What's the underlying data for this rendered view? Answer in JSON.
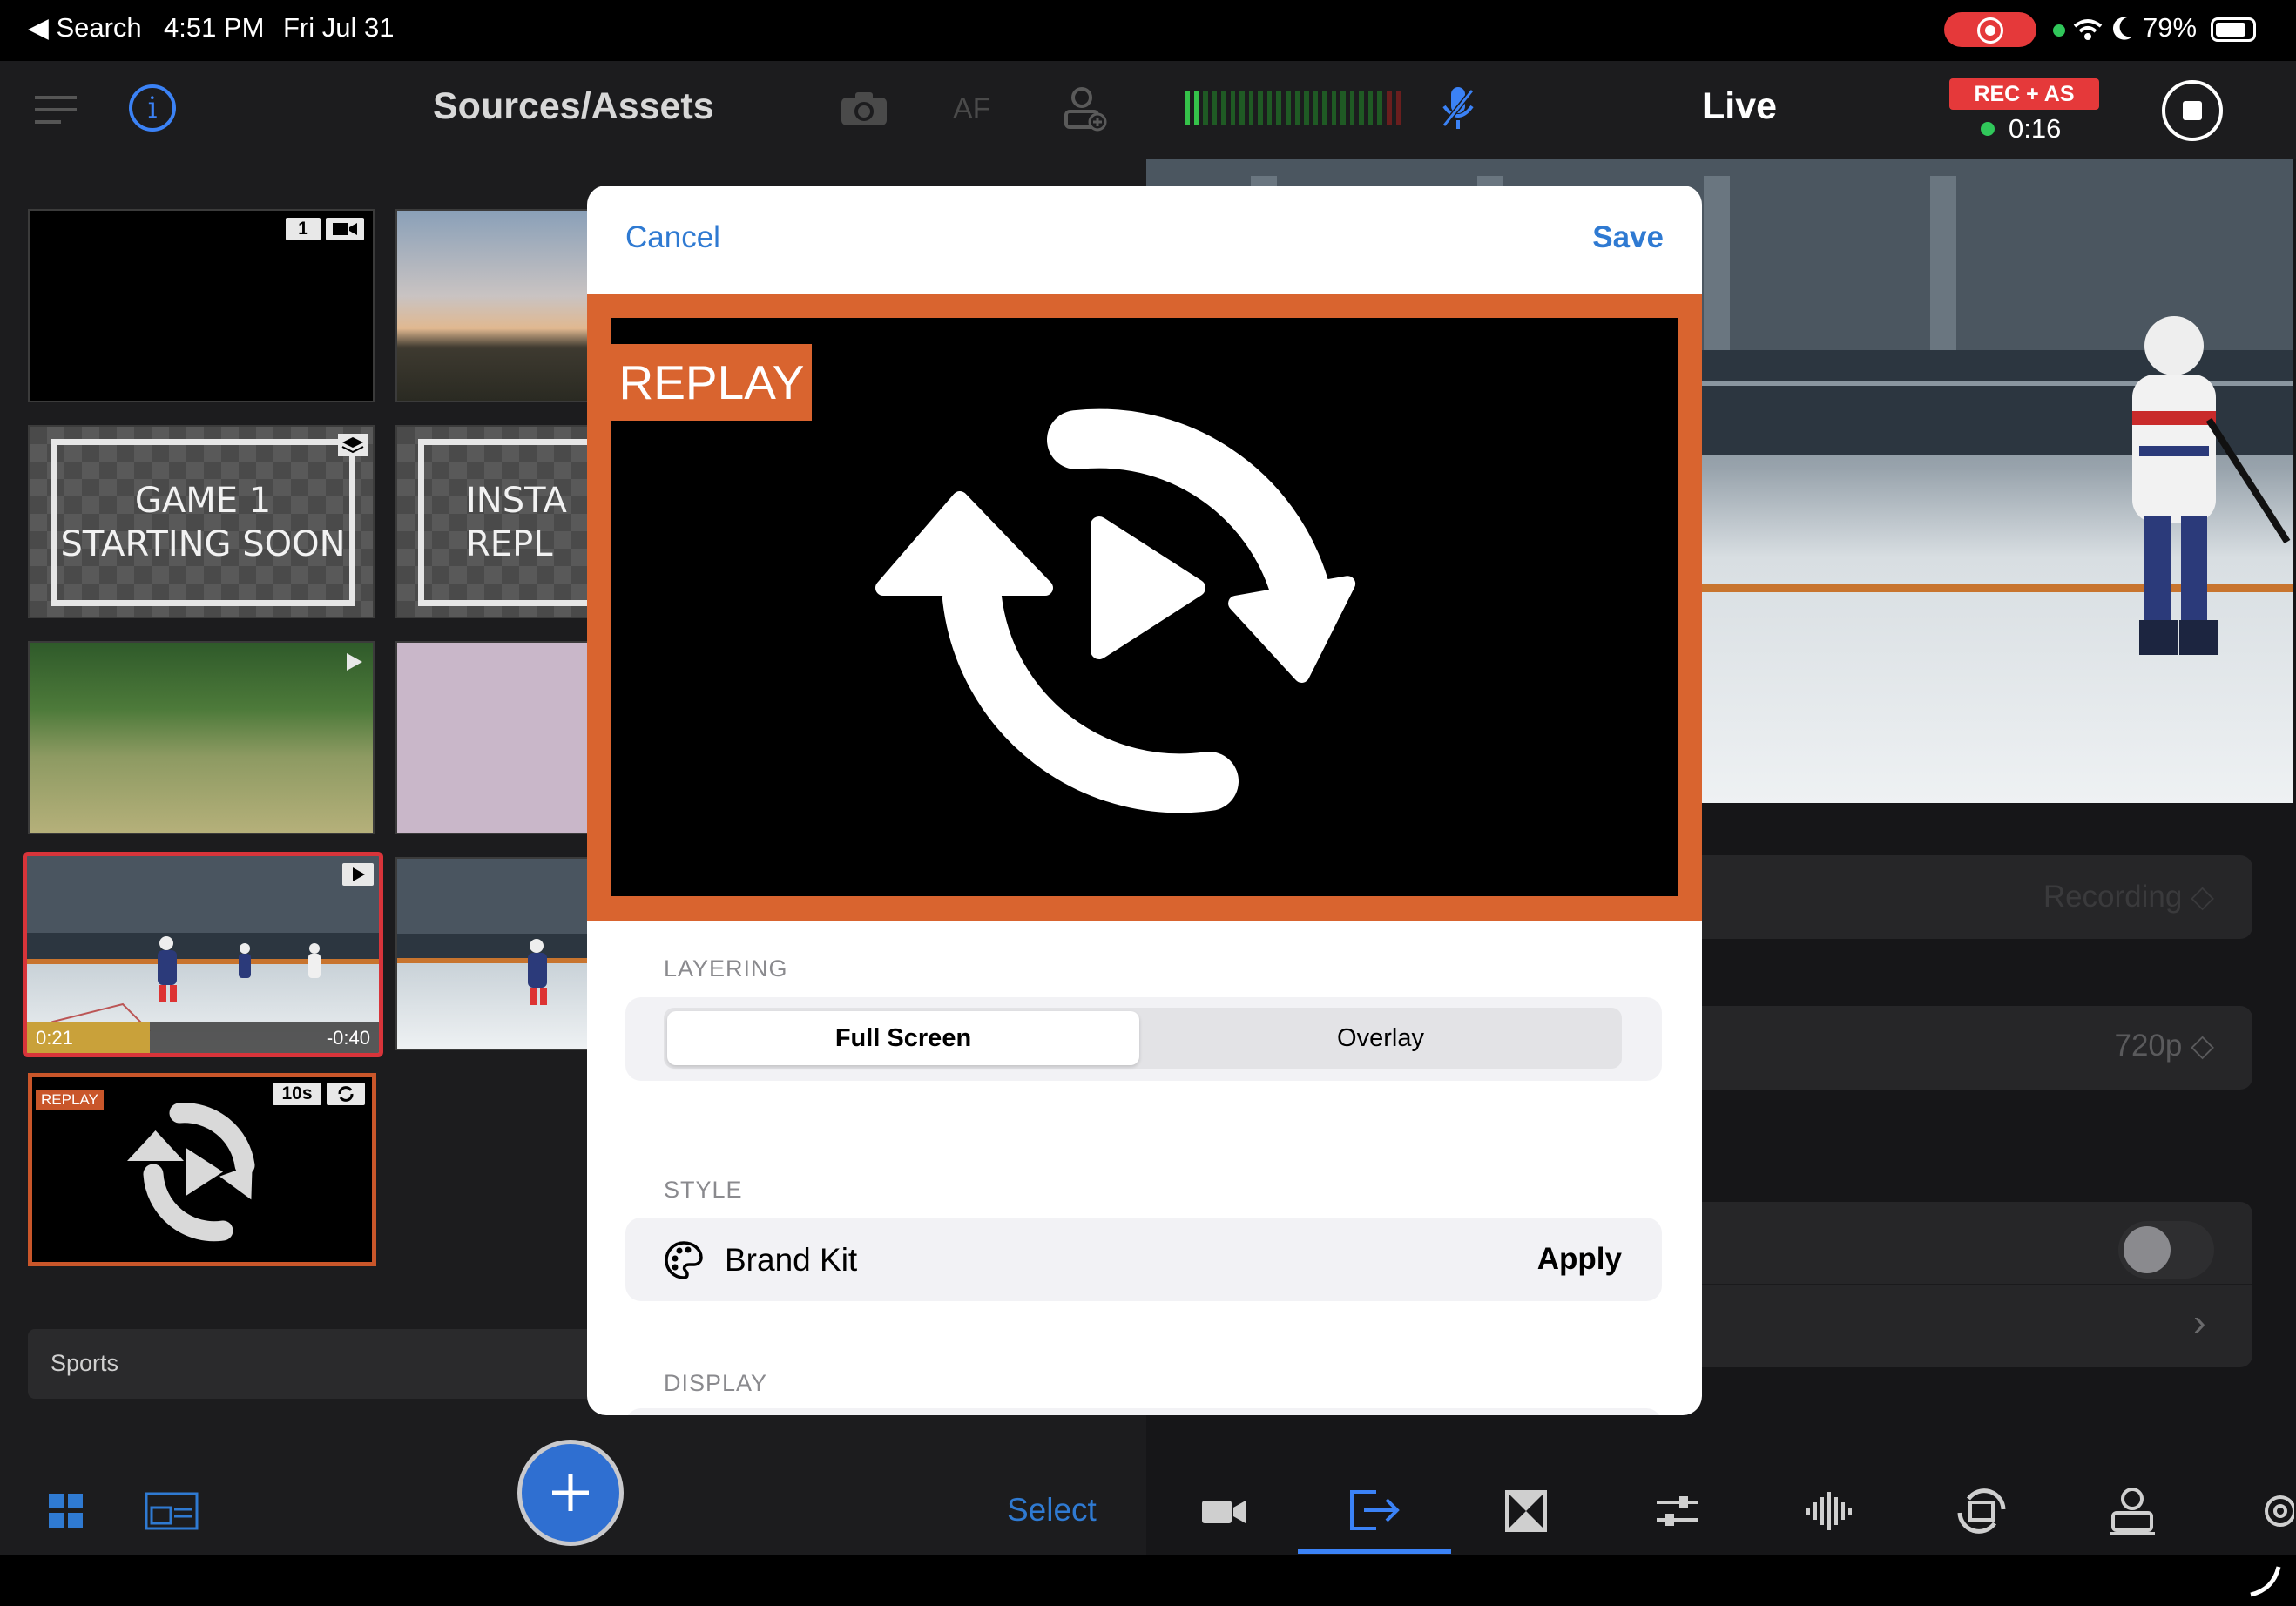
{
  "status_bar": {
    "back_label": "◀ Search",
    "time": "4:51 PM",
    "date": "Fri Jul 31",
    "battery": "79%"
  },
  "sources": {
    "title": "Sources/Assets",
    "af_label": "AF",
    "thumbs": {
      "camera_badge_num": "1",
      "title_card_text": "GAME 1\nSTARTING SOON",
      "instant_replay_text": "INSTA\nREPL",
      "clip_elapsed": "0:21",
      "clip_remaining": "-0:40",
      "clip_progress": 0.35,
      "replay_badge": "REPLAY",
      "replay_duration": "10s"
    },
    "scene_name": "Sports",
    "select_label": "Select"
  },
  "live": {
    "title": "Live",
    "rec_badge": "REC + AS",
    "rec_time": "0:16",
    "recording_option": "Recording ◇",
    "resolution_option": "720p ◇",
    "chevron": "›"
  },
  "modal": {
    "cancel_label": "Cancel",
    "save_label": "Save",
    "preview_label": "REPLAY",
    "layering_label": "LAYERING",
    "layering_options": [
      "Full Screen",
      "Overlay"
    ],
    "layering_selected": "Full Screen",
    "style_label": "STYLE",
    "brand_kit_label": "Brand Kit",
    "apply_label": "Apply",
    "display_label": "DISPLAY"
  },
  "colors": {
    "accent_blue": "#3b82f6",
    "replay_orange": "#d9642f",
    "record_red": "#e5393a",
    "live_green": "#30c75a"
  }
}
